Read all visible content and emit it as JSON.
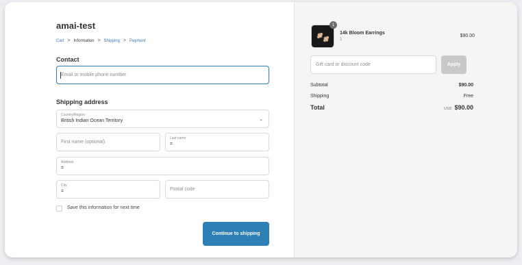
{
  "store": {
    "title": "amai-test"
  },
  "breadcrumb": {
    "cart": "Cart",
    "information": "Information",
    "shipping": "Shipping",
    "payment": "Payment",
    "separator": ">"
  },
  "contact": {
    "heading": "Contact",
    "email_placeholder": "Email or mobile phone number"
  },
  "shipping": {
    "heading": "Shipping address",
    "country_label": "Country/Region",
    "country_value": "British Indian Ocean Territory",
    "first_name_placeholder": "First name (optional)",
    "last_name_label": "Last name",
    "last_name_value": "=",
    "address_label": "Address",
    "address_value": "=",
    "city_label": "City",
    "city_value": "=",
    "postal_placeholder": "Postal code",
    "save_info_label": "Save this information for next time",
    "continue_label": "Continue to shipping"
  },
  "summary": {
    "product_name": "14k Bloom Earrings",
    "product_qty": "1",
    "product_badge": "1",
    "product_price": "$90.00",
    "discount_placeholder": "Gift card or discount code",
    "apply_label": "Apply",
    "subtotal_label": "Subtotal",
    "subtotal_value": "$90.00",
    "shipping_label": "Shipping",
    "shipping_value": "Free",
    "total_label": "Total",
    "currency": "USD",
    "total_value": "$90.00"
  },
  "colors": {
    "accent": "#2f7fb7",
    "link": "#3a78b8",
    "summary_bg": "#f5f5f5"
  },
  "icons": {
    "dropdown": "chevron-down-icon",
    "product": "earrings-thumbnail"
  }
}
